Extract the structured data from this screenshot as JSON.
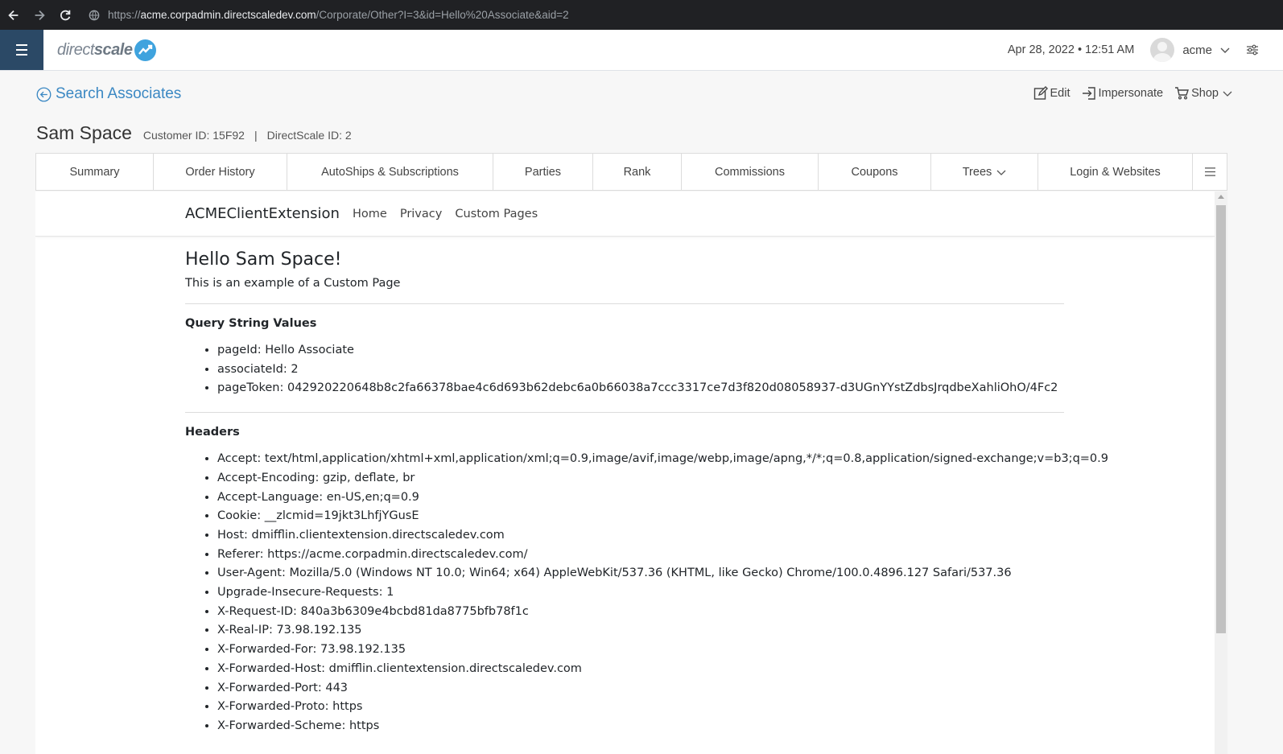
{
  "browser": {
    "url_scheme": "https://",
    "url_host": "acme.corpadmin.directscaledev.com",
    "url_path": "/Corporate/Other?I=3&id=Hello%20Associate&aid=2"
  },
  "header": {
    "logo_text_light": "direct",
    "logo_text_bold": "scale",
    "datetime": "Apr 28, 2022 • 12:51 AM",
    "user": "acme"
  },
  "page": {
    "back_label": "Search Associates",
    "actions": {
      "edit": "Edit",
      "impersonate": "Impersonate",
      "shop": "Shop"
    },
    "name": "Sam Space",
    "customer_id": "Customer ID: 15F92",
    "separator": "|",
    "directscale_id": "DirectScale ID: 2"
  },
  "tabs": [
    {
      "label": "Summary"
    },
    {
      "label": "Order History"
    },
    {
      "label": "AutoShips & Subscriptions"
    },
    {
      "label": "Parties"
    },
    {
      "label": "Rank"
    },
    {
      "label": "Commissions"
    },
    {
      "label": "Coupons"
    },
    {
      "label": "Trees"
    },
    {
      "label": "Login & Websites"
    }
  ],
  "extension": {
    "brand": "ACMEClientExtension",
    "links": [
      "Home",
      "Privacy",
      "Custom Pages"
    ],
    "heading": "Hello Sam Space!",
    "lead": "This is an example of a Custom Page",
    "query_title": "Query String Values",
    "query": [
      "pageId: Hello Associate",
      "associateId: 2",
      "pageToken: 042920220648b8c2fa66378bae4c6d693b62debc6a0b66038a7ccc3317ce7d3f820d08058937-d3UGnYYstZdbsJrqdbeXahliOhO/4Fc2"
    ],
    "headers_title": "Headers",
    "headers": [
      "Accept: text/html,application/xhtml+xml,application/xml;q=0.9,image/avif,image/webp,image/apng,*/*;q=0.8,application/signed-exchange;v=b3;q=0.9",
      "Accept-Encoding: gzip, deflate, br",
      "Accept-Language: en-US,en;q=0.9",
      "Cookie: __zlcmid=19jkt3LhfjYGusE",
      "Host: dmifflin.clientextension.directscaledev.com",
      "Referer: https://acme.corpadmin.directscaledev.com/",
      "User-Agent: Mozilla/5.0 (Windows NT 10.0; Win64; x64) AppleWebKit/537.36 (KHTML, like Gecko) Chrome/100.0.4896.127 Safari/537.36",
      "Upgrade-Insecure-Requests: 1",
      "X-Request-ID: 840a3b6309e4bcbd81da8775bfb78f1c",
      "X-Real-IP: 73.98.192.135",
      "X-Forwarded-For: 73.98.192.135",
      "X-Forwarded-Host: dmifflin.clientextension.directscaledev.com",
      "X-Forwarded-Port: 443",
      "X-Forwarded-Proto: https",
      "X-Forwarded-Scheme: https"
    ]
  },
  "colors": {
    "menu_toggle_bg": "#2b4966",
    "link_blue": "#3b88c3",
    "logo_mark": "#3fa3de"
  }
}
